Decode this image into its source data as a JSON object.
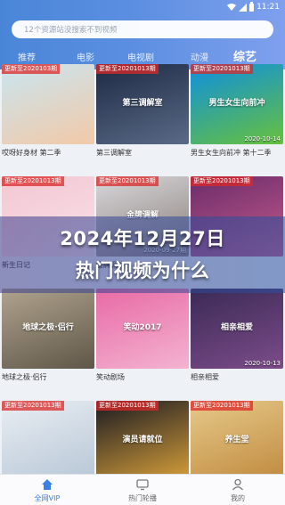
{
  "status": {
    "time": "11:21"
  },
  "search": {
    "placeholder": "12个资源站没搜索不到视频"
  },
  "tabs": [
    {
      "label": "推荐"
    },
    {
      "label": "电影"
    },
    {
      "label": "电视剧"
    },
    {
      "label": "动漫"
    },
    {
      "label": "综艺"
    }
  ],
  "active_tab": "综艺",
  "cards": [
    {
      "badge": "更新至2020103期",
      "title": "",
      "date": "",
      "caption": "哎呀好身材 第二季",
      "color1": "#c9e5f0",
      "color2": "#f2c9a8"
    },
    {
      "badge": "更新至20201013期",
      "title": "第三调解室",
      "date": "",
      "caption": "第三调解室",
      "color1": "#1e2a44",
      "color2": "#5a6a86"
    },
    {
      "badge": "更新至20201013期",
      "title": "男生女生向前冲",
      "date": "2020-10-14",
      "caption": "男生女生向前冲 第十二季",
      "color1": "#0e8fe0",
      "color2": "#67c13c"
    },
    {
      "badge": "更新至20201013期",
      "title": "",
      "date": "",
      "caption": "新生日记",
      "color1": "#f3c6d2",
      "color2": "#f8e2e8"
    },
    {
      "badge": "更新至20201013期",
      "title": "金牌调解",
      "date": "2020-09-27期",
      "caption": "金牌调解",
      "color1": "#d8d8dc",
      "color2": "#8a7d78"
    },
    {
      "badge": "更新至20201013期",
      "title": "",
      "date": "",
      "caption": "",
      "color1": "#6a2c6a",
      "color2": "#c55b8a"
    },
    {
      "badge": "",
      "title": "地球之极·侣行",
      "date": "",
      "caption": "地球之极·侣行",
      "color1": "#b0a48e",
      "color2": "#5f5648"
    },
    {
      "badge": "",
      "title": "笑动2017",
      "date": "",
      "caption": "笑动剧场",
      "color1": "#e86aa5",
      "color2": "#f4b3d1"
    },
    {
      "badge": "",
      "title": "相亲相爱",
      "date": "2020-10-13",
      "caption": "相亲相爱",
      "color1": "#3a2a55",
      "color2": "#7c4c8a"
    },
    {
      "badge": "更新至20201013期",
      "title": "",
      "date": "",
      "caption": "",
      "color1": "#e9eef3",
      "color2": "#b7c6d6"
    },
    {
      "badge": "更新至20201013期",
      "title": "演员请就位",
      "date": "",
      "caption": "",
      "color1": "#1a1a22",
      "color2": "#d8a03a"
    },
    {
      "badge": "更新至20201013期",
      "title": "养生堂",
      "date": "",
      "caption": "",
      "color1": "#e6c98a",
      "color2": "#c08a3e"
    }
  ],
  "overlay": {
    "line1": "2024年12月27日",
    "line2": "热门视频为什么"
  },
  "bottom_nav": [
    {
      "label": "全网VIP",
      "icon": "home-icon"
    },
    {
      "label": "热门轮播",
      "icon": "tv-icon"
    },
    {
      "label": "我的",
      "icon": "user-icon"
    }
  ],
  "colors": {
    "accent": "#3b7ee6",
    "header_start": "#4a86d8",
    "header_end": "#7fa0ee"
  }
}
